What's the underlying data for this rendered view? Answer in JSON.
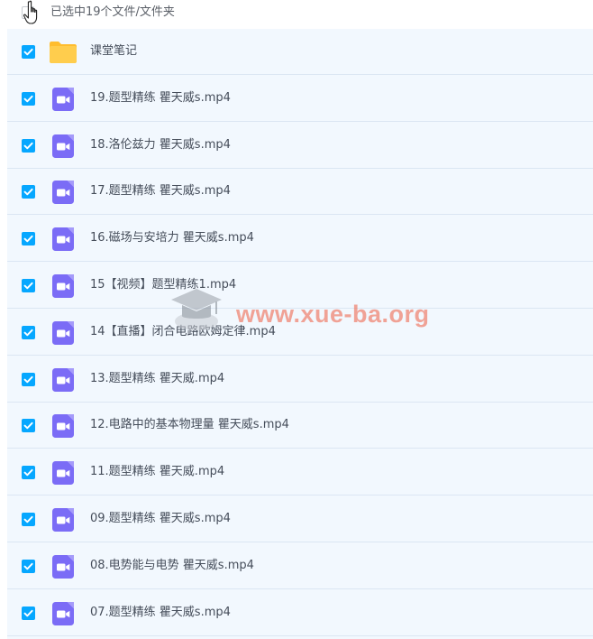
{
  "header": {
    "selection_text": "已选中19个文件/文件夹"
  },
  "files": [
    {
      "name": "课堂笔记",
      "type": "folder",
      "checked": true
    },
    {
      "name": "19.题型精练 瞿天威s.mp4",
      "type": "video",
      "checked": true
    },
    {
      "name": "18.洛伦兹力 瞿天威s.mp4",
      "type": "video",
      "checked": true
    },
    {
      "name": "17.题型精练 瞿天威s.mp4",
      "type": "video",
      "checked": true
    },
    {
      "name": "16.磁场与安培力 瞿天威s.mp4",
      "type": "video",
      "checked": true
    },
    {
      "name": "15【视频】题型精练1.mp4",
      "type": "video",
      "checked": true
    },
    {
      "name": "14【直播】闭合电路欧姆定律.mp4",
      "type": "video",
      "checked": true
    },
    {
      "name": "13.题型精练 瞿天威.mp4",
      "type": "video",
      "checked": true
    },
    {
      "name": "12.电路中的基本物理量 瞿天威s.mp4",
      "type": "video",
      "checked": true
    },
    {
      "name": "11.题型精练 瞿天威.mp4",
      "type": "video",
      "checked": true
    },
    {
      "name": "09.题型精练 瞿天威s.mp4",
      "type": "video",
      "checked": true
    },
    {
      "name": "08.电势能与电势 瞿天威s.mp4",
      "type": "video",
      "checked": true
    },
    {
      "name": "07.题型精练 瞿天威s.mp4",
      "type": "video",
      "checked": true
    }
  ],
  "watermark": {
    "text": "www.xue-ba.org"
  },
  "colors": {
    "checkbox": "#06a7ff",
    "row_background": "#f2f8fe",
    "video_icon": "#7b6cf6",
    "folder_icon": "#ffcd4d"
  }
}
